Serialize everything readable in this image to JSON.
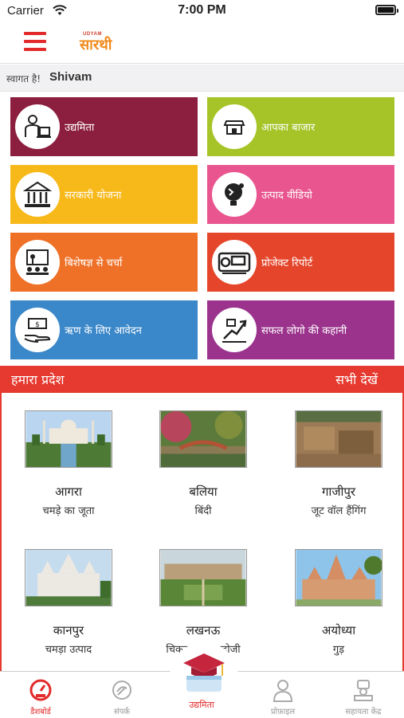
{
  "status_bar": {
    "carrier": "Carrier",
    "time": "7:00 PM"
  },
  "header": {
    "logo_small": "UDYAM",
    "logo_text": "सारथी"
  },
  "welcome": {
    "greeting": "स्वागत है!",
    "user_name": "Shivam"
  },
  "tiles": [
    {
      "label": "उद्यमिता",
      "color": "#8c1f3f",
      "icon": "entrepreneur-icon"
    },
    {
      "label": "आपका बाजार",
      "color": "#a6c427",
      "icon": "market-icon"
    },
    {
      "label": "सरकारी योजना",
      "color": "#f7b81a",
      "icon": "government-icon"
    },
    {
      "label": "उत्पाद वीडियो",
      "color": "#e8558f",
      "icon": "product-video-icon"
    },
    {
      "label": "बिशेषज्ञ से चर्चा",
      "color": "#ef7128",
      "icon": "expert-talk-icon"
    },
    {
      "label": "प्रोजेक्ट रिपोर्ट",
      "color": "#e5462b",
      "icon": "project-report-icon"
    },
    {
      "label": "ऋण के लिए आवेदन",
      "color": "#3a87c9",
      "icon": "loan-icon"
    },
    {
      "label": "सफल लोगो की कहानी",
      "color": "#9b338d",
      "icon": "success-story-icon"
    }
  ],
  "region": {
    "title": "हमारा प्रदेश",
    "see_all": "सभी देखें",
    "places": [
      {
        "name": "आगरा",
        "product": "चमड़े का जूता"
      },
      {
        "name": "बलिया",
        "product": "बिंदी"
      },
      {
        "name": "गाजीपुर",
        "product": "जूट वॉल हैंगिंग"
      },
      {
        "name": "कानपुर",
        "product": "चमड़ा उत्पाद"
      },
      {
        "name": "लखनऊ",
        "product": "चिकनकारी जरदोजी"
      },
      {
        "name": "अयोध्या",
        "product": "गुड़"
      }
    ]
  },
  "tabbar": {
    "items": [
      {
        "label": "डैशबोर्ड",
        "icon": "dashboard-icon",
        "active": true
      },
      {
        "label": "संपर्क",
        "icon": "contact-icon",
        "active": false
      },
      {
        "label": "उद्यमिता",
        "icon": "graduation-cap-icon",
        "active": false
      },
      {
        "label": "प्रोफ़ाइल",
        "icon": "profile-icon",
        "active": false
      },
      {
        "label": "सहायता केंद्र",
        "icon": "help-center-icon",
        "active": false
      }
    ]
  },
  "colors": {
    "brand_red": "#e32a2a",
    "region_red": "#e6392f",
    "logo_orange": "#f08a1c"
  }
}
